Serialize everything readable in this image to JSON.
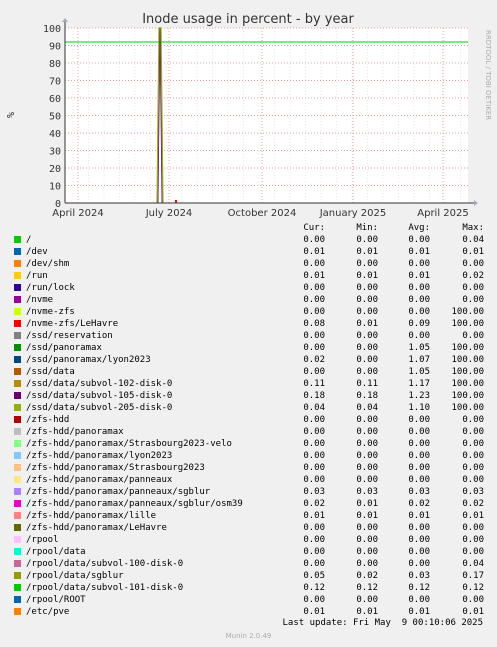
{
  "chart_data": {
    "type": "line",
    "title": "Inode usage in percent - by year",
    "ylabel": "%",
    "xlabel": "",
    "ylim": [
      0,
      100
    ],
    "yticks": [
      0,
      10,
      20,
      30,
      40,
      50,
      60,
      70,
      80,
      90,
      100
    ],
    "xticks": [
      "April 2024",
      "July 2024",
      "October 2024",
      "January 2025",
      "April 2025"
    ],
    "watermark": "RRDTOOL / TOBI OETIKER",
    "warning_line": 92,
    "spike": {
      "label": "/ssd/data/subvol-205-disk-0",
      "date": "June 2024",
      "peak": 100
    },
    "grid": true
  },
  "legend": {
    "headers": {
      "cur": "Cur:",
      "min": "Min:",
      "avg": "Avg:",
      "max": "Max:"
    },
    "rows": [
      {
        "label": "/",
        "color": "#00cc00",
        "cur": "0.00",
        "min": "0.00",
        "avg": "0.00",
        "max": "0.04"
      },
      {
        "label": "/dev",
        "color": "#0066b3",
        "cur": "0.01",
        "min": "0.01",
        "avg": "0.01",
        "max": "0.01"
      },
      {
        "label": "/dev/shm",
        "color": "#ff8000",
        "cur": "0.00",
        "min": "0.00",
        "avg": "0.00",
        "max": "0.00"
      },
      {
        "label": "/run",
        "color": "#ffcc00",
        "cur": "0.01",
        "min": "0.01",
        "avg": "0.01",
        "max": "0.02"
      },
      {
        "label": "/run/lock",
        "color": "#330099",
        "cur": "0.00",
        "min": "0.00",
        "avg": "0.00",
        "max": "0.00"
      },
      {
        "label": "/nvme",
        "color": "#990099",
        "cur": "0.00",
        "min": "0.00",
        "avg": "0.00",
        "max": "0.00"
      },
      {
        "label": "/nvme-zfs",
        "color": "#ccff00",
        "cur": "0.00",
        "min": "0.00",
        "avg": "0.00",
        "max": "100.00"
      },
      {
        "label": "/nvme-zfs/LeHavre",
        "color": "#ff0000",
        "cur": "0.08",
        "min": "0.01",
        "avg": "0.09",
        "max": "100.00"
      },
      {
        "label": "/ssd/reservation",
        "color": "#808080",
        "cur": "0.00",
        "min": "0.00",
        "avg": "0.00",
        "max": "0.00"
      },
      {
        "label": "/ssd/panoramax",
        "color": "#008f00",
        "cur": "0.00",
        "min": "0.00",
        "avg": "1.05",
        "max": "100.00"
      },
      {
        "label": "/ssd/panoramax/lyon2023",
        "color": "#00487d",
        "cur": "0.02",
        "min": "0.00",
        "avg": "1.07",
        "max": "100.00"
      },
      {
        "label": "/ssd/data",
        "color": "#b35a00",
        "cur": "0.00",
        "min": "0.00",
        "avg": "1.05",
        "max": "100.00"
      },
      {
        "label": "/ssd/data/subvol-102-disk-0",
        "color": "#b38f00",
        "cur": "0.11",
        "min": "0.11",
        "avg": "1.17",
        "max": "100.00"
      },
      {
        "label": "/ssd/data/subvol-105-disk-0",
        "color": "#6b006b",
        "cur": "0.18",
        "min": "0.18",
        "avg": "1.23",
        "max": "100.00"
      },
      {
        "label": "/ssd/data/subvol-205-disk-0",
        "color": "#8fb300",
        "cur": "0.04",
        "min": "0.04",
        "avg": "1.10",
        "max": "100.00"
      },
      {
        "label": "/zfs-hdd",
        "color": "#b30000",
        "cur": "0.00",
        "min": "0.00",
        "avg": "0.00",
        "max": "0.00"
      },
      {
        "label": "/zfs-hdd/panoramax",
        "color": "#bebebe",
        "cur": "0.00",
        "min": "0.00",
        "avg": "0.00",
        "max": "0.00"
      },
      {
        "label": "/zfs-hdd/panoramax/Strasbourg2023-velo",
        "color": "#80ff80",
        "cur": "0.00",
        "min": "0.00",
        "avg": "0.00",
        "max": "0.00"
      },
      {
        "label": "/zfs-hdd/panoramax/lyon2023",
        "color": "#80c9ff",
        "cur": "0.00",
        "min": "0.00",
        "avg": "0.00",
        "max": "0.00"
      },
      {
        "label": "/zfs-hdd/panoramax/Strasbourg2023",
        "color": "#ffc080",
        "cur": "0.00",
        "min": "0.00",
        "avg": "0.00",
        "max": "0.00"
      },
      {
        "label": "/zfs-hdd/panoramax/panneaux",
        "color": "#ffe680",
        "cur": "0.00",
        "min": "0.00",
        "avg": "0.00",
        "max": "0.00"
      },
      {
        "label": "/zfs-hdd/panoramax/panneaux/sgblur",
        "color": "#aa80ff",
        "cur": "0.03",
        "min": "0.03",
        "avg": "0.03",
        "max": "0.03"
      },
      {
        "label": "/zfs-hdd/panoramax/panneaux/sgblur/osm39",
        "color": "#ee00cc",
        "cur": "0.02",
        "min": "0.01",
        "avg": "0.02",
        "max": "0.02"
      },
      {
        "label": "/zfs-hdd/panoramax/lille",
        "color": "#ff8080",
        "cur": "0.01",
        "min": "0.01",
        "avg": "0.01",
        "max": "0.01"
      },
      {
        "label": "/zfs-hdd/panoramax/LeHavre",
        "color": "#666600",
        "cur": "0.00",
        "min": "0.00",
        "avg": "0.00",
        "max": "0.00"
      },
      {
        "label": "/rpool",
        "color": "#ffbfff",
        "cur": "0.00",
        "min": "0.00",
        "avg": "0.00",
        "max": "0.00"
      },
      {
        "label": "/rpool/data",
        "color": "#00ffcc",
        "cur": "0.00",
        "min": "0.00",
        "avg": "0.00",
        "max": "0.00"
      },
      {
        "label": "/rpool/data/subvol-100-disk-0",
        "color": "#cc6699",
        "cur": "0.00",
        "min": "0.00",
        "avg": "0.00",
        "max": "0.04"
      },
      {
        "label": "/rpool/data/sgblur",
        "color": "#999900",
        "cur": "0.05",
        "min": "0.02",
        "avg": "0.03",
        "max": "0.17"
      },
      {
        "label": "/rpool/data/subvol-101-disk-0",
        "color": "#00cc00",
        "cur": "0.12",
        "min": "0.12",
        "avg": "0.12",
        "max": "0.12"
      },
      {
        "label": "/rpool/ROOT",
        "color": "#0066b3",
        "cur": "0.00",
        "min": "0.00",
        "avg": "0.00",
        "max": "0.00"
      },
      {
        "label": "/etc/pve",
        "color": "#ff8000",
        "cur": "0.01",
        "min": "0.01",
        "avg": "0.01",
        "max": "0.01"
      }
    ]
  },
  "footer": {
    "last_update": "Last update: Fri May  9 00:10:06 2025",
    "munin": "Munin 2.0.49"
  },
  "colors": {
    "background": "#f0f0f0",
    "plot_bg": "#ffffff",
    "grid_major": "#e0a0a0",
    "grid_minor": "#e8e8e8",
    "warning": "#00cc00",
    "spike": "#8fb300"
  }
}
